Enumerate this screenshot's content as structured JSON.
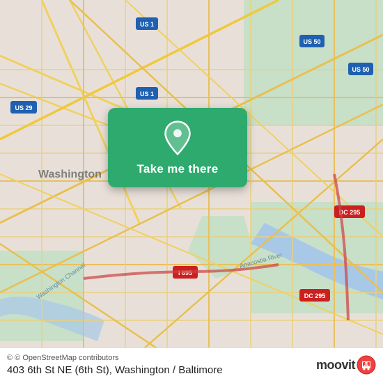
{
  "map": {
    "background_color": "#e8e0d8",
    "center": "Washington DC"
  },
  "card": {
    "label": "Take me there",
    "background_color": "#2eaa6e"
  },
  "bottom_bar": {
    "attribution": "© OpenStreetMap contributors",
    "address": "403 6th St NE (6th St), Washington / Baltimore"
  },
  "moovit": {
    "text": "moovit"
  }
}
